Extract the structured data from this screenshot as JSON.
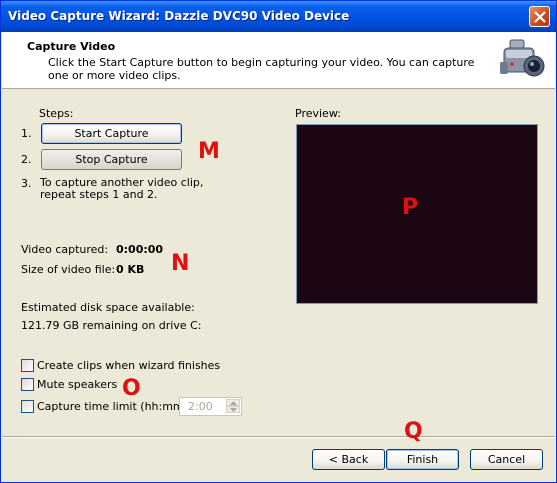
{
  "window": {
    "title": "Video Capture Wizard: Dazzle DVC90 Video Device"
  },
  "header": {
    "title": "Capture Video",
    "description": "Click the Start Capture button to begin capturing your video. You can capture one or more video clips.",
    "icon": "camcorder-icon"
  },
  "steps": {
    "label": "Steps:",
    "step1_num": "1.",
    "step2_num": "2.",
    "step3_num": "3.",
    "start_label": "Start Capture",
    "stop_label": "Stop Capture",
    "step3_text": "To capture another video clip, repeat steps 1 and 2."
  },
  "stats": {
    "captured_label": "Video captured:",
    "captured_value": "0:00:00",
    "size_label": "Size of video file:",
    "size_value": "0 KB",
    "disk_label": "Estimated disk space available:",
    "disk_value": "121.79 GB remaining on drive C:"
  },
  "preview": {
    "label": "Preview:",
    "background": "#1c0614"
  },
  "options": {
    "create_clips": "Create clips when wizard finishes",
    "mute": "Mute speakers",
    "time_limit": "Capture time limit (hh:mm):",
    "time_value": "2:00"
  },
  "footer": {
    "back": "< Back",
    "finish": "Finish",
    "cancel": "Cancel"
  },
  "markers": {
    "m": "M",
    "n": "N",
    "o": "O",
    "p": "P",
    "q": "Q"
  }
}
